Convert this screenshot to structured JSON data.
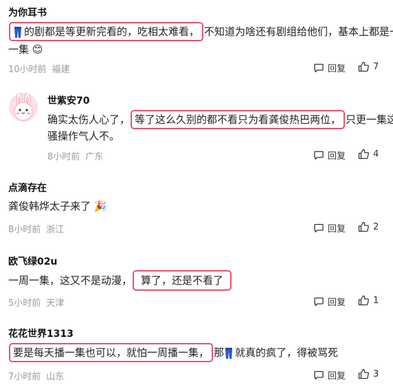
{
  "comments": [
    {
      "username": "为你耳书",
      "line1_pre": "的剧都是等更新完看的，",
      "line1_hl": "吃相太难看，",
      "line1_post": "不知道为啥还有剧组给他们，基本上都是一天",
      "line2": "一集 😊",
      "time": "10小时前",
      "location": "福建",
      "reply_label": "回复",
      "likes": "7"
    },
    {
      "username": "世紫安70",
      "line1_pre": "确实太伤人心了，",
      "line1_hl": "等了这么久别的都不看只为看龚俊热巴两位，",
      "line1_post": "只更一集这波",
      "line2": "骚操作气人不。",
      "time": "8小时前",
      "location": "广东",
      "reply_label": "回复",
      "likes": "4"
    },
    {
      "username": "点滴存在",
      "line1": "龚俊韩烨太子来了 🎉",
      "time": "8小时前",
      "location": "浙江",
      "reply_label": "回复",
      "likes": "2"
    },
    {
      "username": "欧飞绿02u",
      "line1_pre": "一周一集，这又不是动漫，",
      "line1_hl": "算了，还是不看了",
      "time": "5小时前",
      "location": "天津",
      "reply_label": "回复",
      "likes": "1"
    },
    {
      "username": "花花世界1313",
      "line1_hl": "要是每天播一集也可以，就怕一周播一集，",
      "line1_post_a": "那",
      "line1_post_b": "就真的疯了，得被骂死",
      "time": "7小时前",
      "location": "山东",
      "reply_label": "回复",
      "likes": "3"
    }
  ],
  "colors": {
    "highlight_border": "#e5536e",
    "meta_text": "#9a9a9a"
  },
  "icons": [
    "jeans-emoji-icon",
    "reply-icon",
    "thumbs-up-icon",
    "bunny-avatar"
  ]
}
